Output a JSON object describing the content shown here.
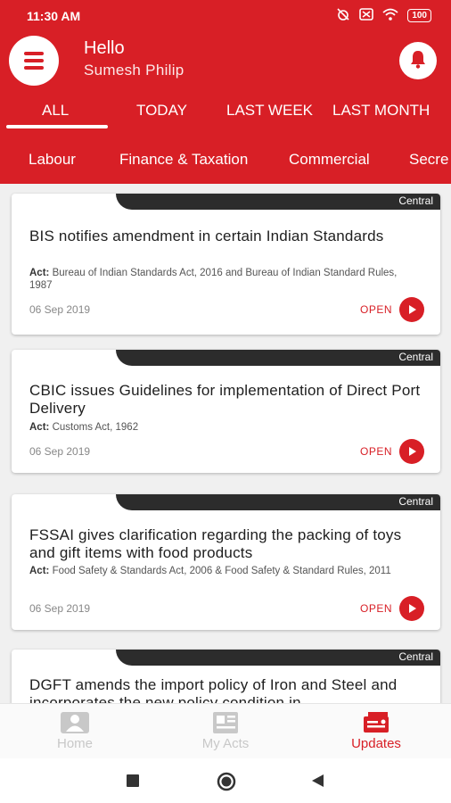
{
  "status_bar": {
    "time": "11:30 AM",
    "battery": "100"
  },
  "header": {
    "greeting": "Hello",
    "user_name": "Sumesh Philip"
  },
  "tabs": [
    "ALL",
    "TODAY",
    "LAST WEEK",
    "LAST MONTH"
  ],
  "categories": [
    "Labour",
    "Finance & Taxation",
    "Commercial",
    "Secre"
  ],
  "cards": [
    {
      "tag": "Central",
      "title": "BIS notifies amendment in certain Indian Standards",
      "act_label": "Act:",
      "act": "Bureau of Indian Standards Act, 2016 and Bureau of Indian Standard Rules, 1987",
      "date": "06 Sep 2019",
      "open": "OPEN"
    },
    {
      "tag": "Central",
      "title": "CBIC issues Guidelines for implementation of Direct Port Delivery",
      "act_label": "Act:",
      "act": "Customs Act, 1962",
      "date": "06 Sep 2019",
      "open": "OPEN"
    },
    {
      "tag": "Central",
      "title": "FSSAI gives clarification regarding the packing of toys and gift items with food products",
      "act_label": "Act:",
      "act": "Food Safety & Standards Act, 2006 & Food Safety & Standard Rules, 2011",
      "date": "06 Sep 2019",
      "open": "OPEN"
    },
    {
      "tag": "Central",
      "title": "DGFT amends the import policy of Iron and Steel and incorporates the new policy condition in"
    }
  ],
  "bottom_nav": [
    {
      "label": "Home",
      "icon": "home-icon"
    },
    {
      "label": "My Acts",
      "icon": "document-icon"
    },
    {
      "label": "Updates",
      "icon": "updates-icon"
    }
  ],
  "colors": {
    "primary": "#d81f26",
    "tag": "#2c2c2c",
    "inactive": "#c8c8c8"
  }
}
